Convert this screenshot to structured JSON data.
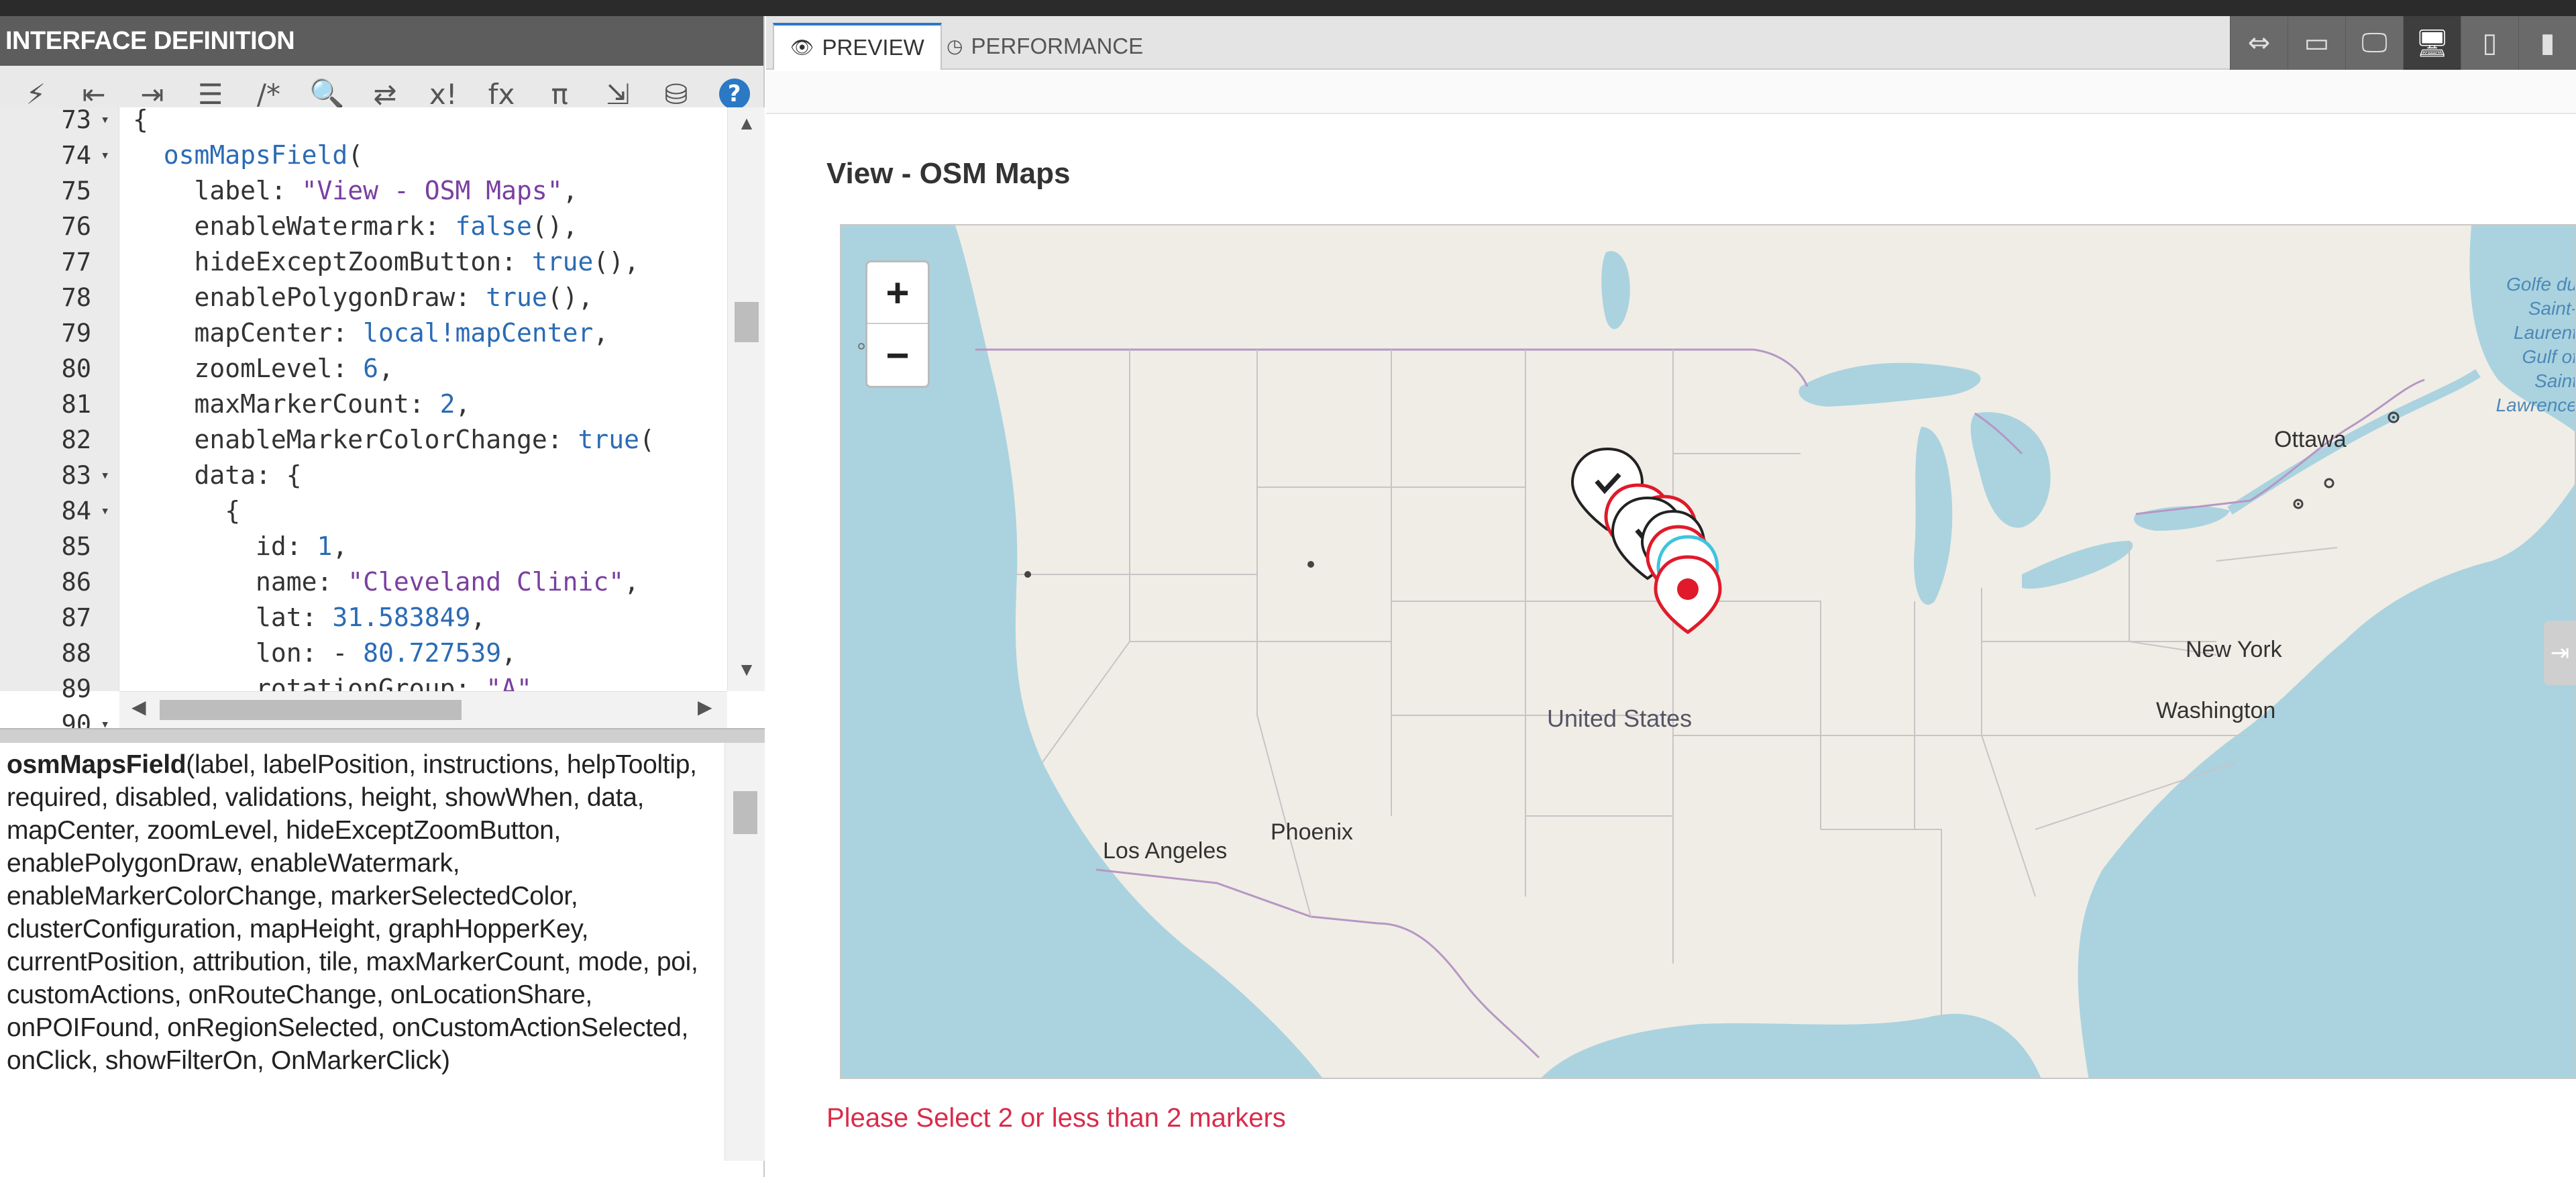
{
  "left_panel": {
    "title": "INTERFACE DEFINITION",
    "toolbar": [
      {
        "name": "magic-wand-icon",
        "glyph": "⚡"
      },
      {
        "name": "outdent-icon",
        "glyph": "⇤"
      },
      {
        "name": "indent-icon",
        "glyph": "⇥"
      },
      {
        "name": "format-list-icon",
        "glyph": "☰"
      },
      {
        "name": "comment-icon",
        "glyph": "/*"
      },
      {
        "name": "search-icon",
        "glyph": "🔍"
      },
      {
        "name": "shuffle-icon",
        "glyph": "⇄"
      },
      {
        "name": "expression-icon",
        "glyph": "x!"
      },
      {
        "name": "function-icon",
        "glyph": "fx"
      },
      {
        "name": "pi-icon",
        "glyph": "π"
      },
      {
        "name": "export-icon",
        "glyph": "⇲"
      },
      {
        "name": "database-icon",
        "glyph": "⛁"
      },
      {
        "name": "help-icon",
        "glyph": "?"
      }
    ],
    "code_lines": [
      {
        "n": "73",
        "fold": "▾",
        "html": "{"
      },
      {
        "n": "74",
        "fold": "▾",
        "html": "  <span class='k-fn'>osmMapsField</span>("
      },
      {
        "n": "75",
        "fold": "",
        "html": "    label: <span class='k-str'>\"View - OSM Maps\"</span>,"
      },
      {
        "n": "76",
        "fold": "",
        "html": "    enableWatermark: <span class='k-kw'>false</span>(),"
      },
      {
        "n": "77",
        "fold": "",
        "html": "    hideExceptZoomButton: <span class='k-kw'>true</span>(),"
      },
      {
        "n": "78",
        "fold": "",
        "html": "    enablePolygonDraw: <span class='k-kw'>true</span>(),"
      },
      {
        "n": "79",
        "fold": "",
        "html": "    mapCenter: <span class='k-kw'>local!mapCenter</span>,"
      },
      {
        "n": "80",
        "fold": "",
        "html": "    zoomLevel: <span class='k-num'>6</span>,"
      },
      {
        "n": "81",
        "fold": "",
        "html": "    maxMarkerCount: <span class='k-num'>2</span>,"
      },
      {
        "n": "82",
        "fold": "",
        "html": "    enableMarkerColorChange: <span class='k-kw'>true</span>("
      },
      {
        "n": "83",
        "fold": "▾",
        "html": "    data: {"
      },
      {
        "n": "84",
        "fold": "▾",
        "html": "      {"
      },
      {
        "n": "85",
        "fold": "",
        "html": "        id: <span class='k-num'>1</span>,"
      },
      {
        "n": "86",
        "fold": "",
        "html": "        name: <span class='k-str'>\"Cleveland Clinic\"</span>,"
      },
      {
        "n": "87",
        "fold": "",
        "html": "        lat: <span class='k-num'>31.583849</span>,"
      },
      {
        "n": "88",
        "fold": "",
        "html": "        lon: - <span class='k-num'>80.727539</span>,"
      },
      {
        "n": "89",
        "fold": "",
        "html": "        rotationGroup: <span class='k-str'>\"A\"</span>,"
      },
      {
        "n": "90",
        "fold": "▾",
        "html": ""
      }
    ],
    "doc_fn": "osmMapsField",
    "doc_params": "(label, labelPosition, instructions, helpTooltip, required, disabled, validations, height, showWhen, data, mapCenter, zoomLevel, hideExceptZoomButton, enablePolygonDraw, enableWatermark, enableMarkerColorChange, markerSelectedColor, clusterConfiguration, mapHeight, graphHopperKey, currentPosition, attribution, tile, maxMarkerCount, mode, poi, customActions, onRouteChange, onLocationShare, onPOIFound, onRegionSelected, onCustomActionSelected, onClick, showFilterOn, OnMarkerClick)"
  },
  "right_panel": {
    "tabs": [
      {
        "label": "PREVIEW",
        "icon": "👁",
        "icon_name": "eye-icon",
        "active": true
      },
      {
        "label": "PERFORMANCE",
        "icon": "◷",
        "icon_name": "clock-icon",
        "active": false
      }
    ],
    "devices": [
      {
        "name": "fit-width-icon",
        "glyph": "⇔",
        "active": false
      },
      {
        "name": "desktop-wide-icon",
        "glyph": "▭",
        "active": false
      },
      {
        "name": "desktop-icon",
        "glyph": "🖵",
        "active": false
      },
      {
        "name": "monitor-icon",
        "glyph": "🖥",
        "active": true
      },
      {
        "name": "tablet-icon",
        "glyph": "▯",
        "active": false
      },
      {
        "name": "phone-icon",
        "glyph": "▮",
        "active": false
      }
    ],
    "field_label": "View - OSM Maps",
    "validation_message": "Please Select 2 or less than 2 markers",
    "map": {
      "zoom_in": "+",
      "zoom_out": "−",
      "labels": {
        "ottawa": "Ottawa",
        "new_york": "New York",
        "washington": "Washington",
        "united_states": "United States",
        "phoenix": "Phoenix",
        "los_angeles": "Los Angeles",
        "gulf": "Golfe du Saint-Laurent Gulf of Saint Lawrence"
      }
    }
  }
}
